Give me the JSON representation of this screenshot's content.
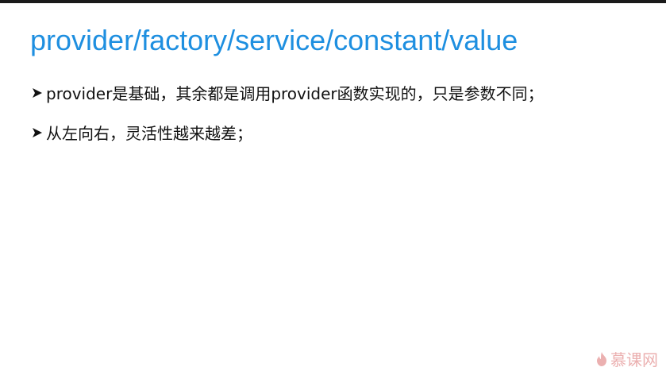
{
  "slide": {
    "title": "provider/factory/service/constant/value",
    "bullets": [
      {
        "text": "provider是基础，其余都是调用provider函数实现的，只是参数不同；"
      },
      {
        "text": "从左向右，灵活性越来越差；"
      }
    ]
  },
  "watermark": {
    "text": "慕课网",
    "icon": "flame-icon"
  },
  "colors": {
    "title": "#1e8fe0",
    "text": "#111111",
    "watermark": "#e8a3a3"
  }
}
